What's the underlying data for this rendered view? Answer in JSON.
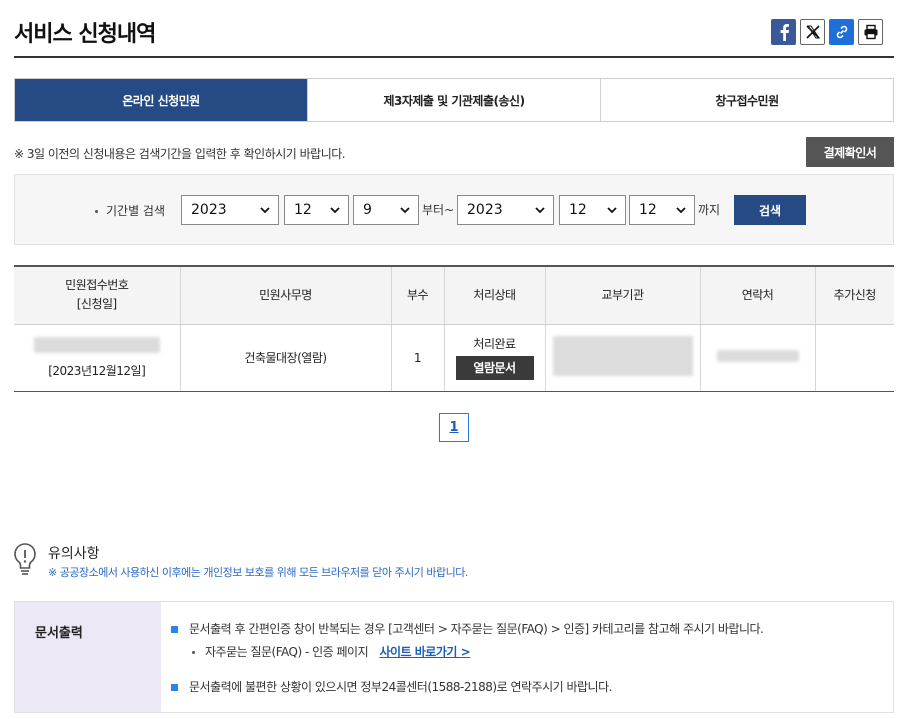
{
  "header": {
    "title": "서비스 신청내역",
    "share_icons": [
      "facebook-icon",
      "x-icon",
      "link-icon",
      "print-icon"
    ]
  },
  "tabs": [
    {
      "label": "온라인 신청민원",
      "active": true
    },
    {
      "label": "제3자제출 및 기관제출(송신)",
      "active": false
    },
    {
      "label": "창구접수민원",
      "active": false
    }
  ],
  "notice": "※ 3일 이전의 신청내용은 검색기간을 입력한 후 확인하시기 바랍니다.",
  "receipt_button": "결제확인서",
  "search": {
    "label": "기간별 검색",
    "from_year": "2023",
    "from_month": "12",
    "from_day": "9",
    "from_suffix": "부터~",
    "to_year": "2023",
    "to_month": "12",
    "to_day": "12",
    "to_suffix": "까지",
    "button": "검색"
  },
  "table": {
    "headers": [
      "민원접수번호",
      "[신청일]",
      "민원사무명",
      "부수",
      "처리상태",
      "교부기관",
      "연락처",
      "추가신청"
    ],
    "rows": [
      {
        "date": "[2023년12월12일]",
        "name": "건축물대장(열람)",
        "count": "1",
        "status": "처리완료",
        "view_button": "열람문서"
      }
    ]
  },
  "pagination": {
    "current": "1"
  },
  "caution": {
    "title": "유의사항",
    "desc": "※ 공공장소에서 사용하신 이후에는 개인정보 보호를 위해 모든 브라우저를 닫아 주시기 바랍니다."
  },
  "info": {
    "title": "문서출력",
    "line1": "문서출력 후 간편인증 창이 반복되는 경우 [고객센터 > 자주묻는 질문(FAQ) > 인증] 카테고리를 참고해 주시기 바랍니다.",
    "sub": "자주묻는 질문(FAQ) - 인증 페이지",
    "link": "사이트 바로가기 >",
    "line2": "문서출력에 불편한 상황이 있으시면 정부24콜센터(1588-2188)로 연락주시기 바랍니다."
  },
  "colors": {
    "primary": "#254a84",
    "accent_link": "#2b68c4",
    "info_bg": "#ece8f6"
  }
}
